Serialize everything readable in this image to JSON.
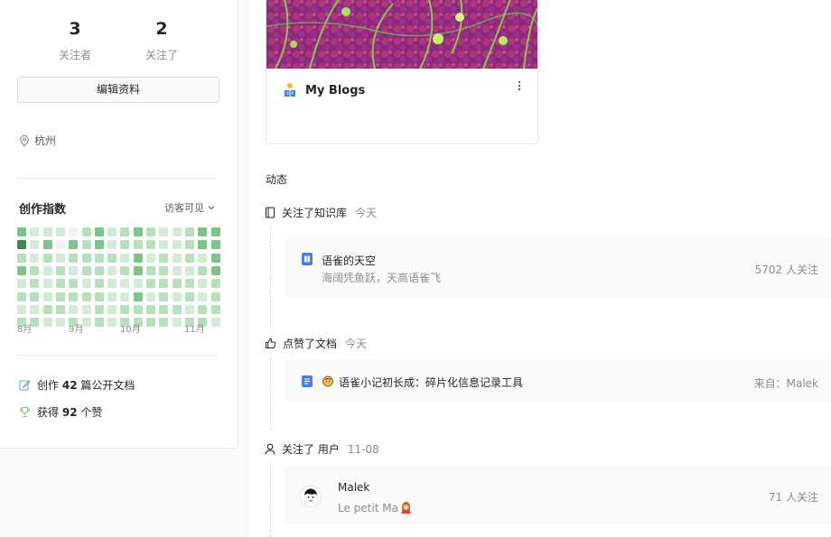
{
  "profile": {
    "followers": {
      "count": "3",
      "label": "关注者"
    },
    "following": {
      "count": "2",
      "label": "关注了"
    },
    "edit_label": "编辑资料",
    "location": "杭州"
  },
  "creation_index": {
    "title": "创作指数",
    "visibility": "访客可见",
    "months": [
      "8月",
      "9月",
      "10月",
      "11月"
    ],
    "levels": [
      [
        3,
        1,
        1,
        1,
        0,
        2,
        3,
        1,
        2,
        3,
        2,
        1,
        1,
        2,
        3,
        3
      ],
      [
        4,
        1,
        3,
        0,
        3,
        2,
        3,
        1,
        2,
        2,
        2,
        1,
        1,
        2,
        3,
        3
      ],
      [
        2,
        1,
        2,
        1,
        2,
        2,
        2,
        2,
        1,
        3,
        1,
        2,
        1,
        2,
        1,
        3
      ],
      [
        3,
        2,
        1,
        2,
        1,
        2,
        2,
        1,
        2,
        3,
        2,
        2,
        1,
        1,
        2,
        3
      ],
      [
        1,
        2,
        1,
        2,
        2,
        1,
        2,
        1,
        1,
        1,
        2,
        2,
        2,
        2,
        1,
        2
      ],
      [
        2,
        2,
        1,
        2,
        2,
        2,
        2,
        1,
        1,
        3,
        1,
        2,
        1,
        2,
        1,
        2
      ],
      [
        1,
        1,
        2,
        2,
        1,
        1,
        2,
        1,
        2,
        2,
        2,
        2,
        2,
        1,
        2,
        2
      ],
      [
        2,
        2,
        1,
        1,
        2,
        1,
        2,
        1,
        2,
        2,
        2,
        2,
        1,
        2,
        2,
        1
      ]
    ],
    "colors": [
      "#f2f2f2",
      "#d4ecd7",
      "#b7e0bd",
      "#7cc487",
      "#3d8a4d"
    ]
  },
  "summary": {
    "docs_prefix": "创作",
    "docs_count": "42",
    "docs_suffix": "篇公开文档",
    "likes_prefix": "获得",
    "likes_count": "92",
    "likes_suffix": "个赞"
  },
  "book": {
    "title": "My Blogs"
  },
  "feed": {
    "section_title": "动态",
    "items": [
      {
        "action": "关注了知识库",
        "time": "今天",
        "title": "语雀的天空",
        "subtitle": "海阔凭鱼跃，天高语雀飞",
        "right": "5702 人关注"
      },
      {
        "action": "点赞了文档",
        "time": "今天",
        "title": "语雀小记初长成：碎片化信息记录工具",
        "right": "来自：Malek"
      },
      {
        "action": "关注了 用户",
        "time": "11-08",
        "title": "Malek",
        "subtitle": "Le petit Ma",
        "right": "71 人关注"
      }
    ]
  },
  "colors": {
    "accent": "#3d8a4d",
    "doc_blue": "#4a7ee6"
  }
}
